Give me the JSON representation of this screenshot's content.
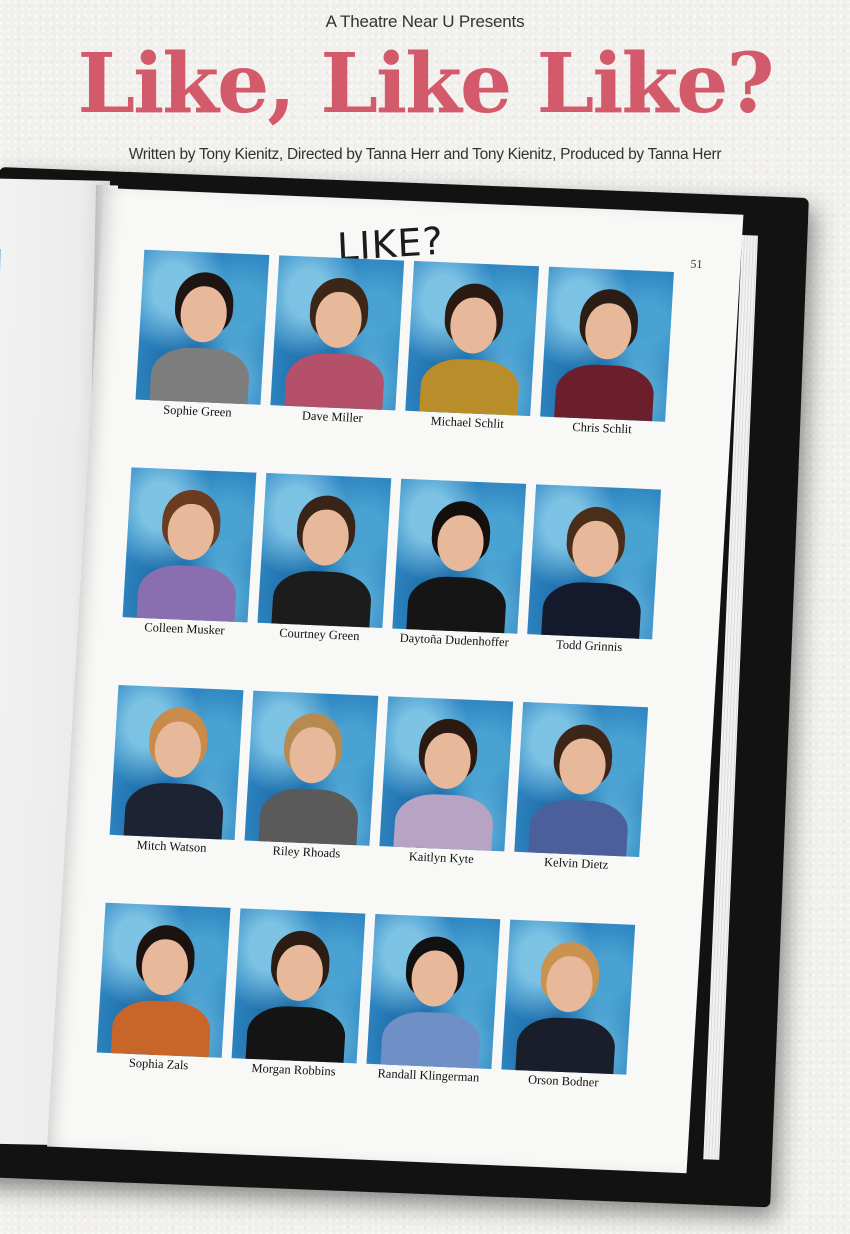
{
  "poster": {
    "presenter": "A Theatre Near U Presents",
    "title": "Like, Like Like?",
    "credits": "Written by Tony Kienitz, Directed by Tanna Herr and Tony Kienitz, Produced by Tanna Herr"
  },
  "yearbook": {
    "page_number": "51",
    "scribble": "LIKE?",
    "students": [
      {
        "name": "Sophie Green"
      },
      {
        "name": "Dave Miller"
      },
      {
        "name": "Michael Schlit"
      },
      {
        "name": "Chris Schlit"
      },
      {
        "name": "Colleen Musker"
      },
      {
        "name": "Courtney Green"
      },
      {
        "name": "Daytoña Dudenhoffer"
      },
      {
        "name": "Todd Grinnis"
      },
      {
        "name": "Mitch Watson"
      },
      {
        "name": "Riley Rhoads"
      },
      {
        "name": "Kaitlyn Kyte"
      },
      {
        "name": "Kelvin Dietz"
      },
      {
        "name": "Sophia Zals"
      },
      {
        "name": "Morgan Robbins"
      },
      {
        "name": "Randall Klingerman"
      },
      {
        "name": "Orson Bodner"
      }
    ]
  },
  "colors": {
    "title": "#d35a6b",
    "photo_background": "#2f86c2",
    "book_cover": "#121212"
  }
}
